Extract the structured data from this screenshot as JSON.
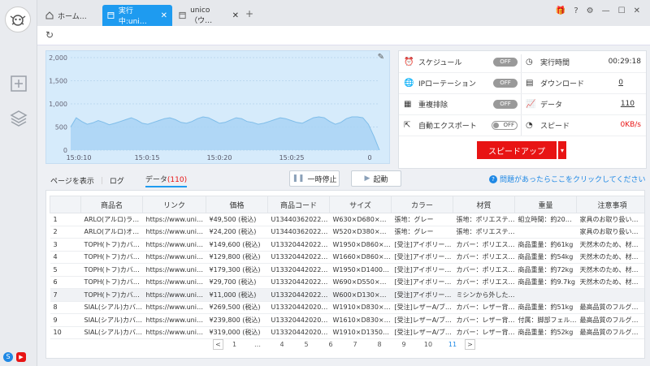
{
  "tabs": [
    {
      "label": "ホーム…",
      "icon": "home-icon"
    },
    {
      "label": "実行中:uni…",
      "icon": "window-icon",
      "active": true
    },
    {
      "label": "unico（ウ…",
      "icon": "window-icon"
    }
  ],
  "chart_data": {
    "type": "area",
    "y_ticks": [
      "2,000",
      "1,500",
      "1,000",
      "500",
      "0"
    ],
    "x_ticks": [
      "15:0:10",
      "15:0:15",
      "15:0:20",
      "15:0:25",
      "0"
    ],
    "ylim": [
      0,
      2000
    ],
    "values": [
      500,
      700,
      620,
      560,
      590,
      640,
      600,
      550,
      580,
      620,
      660,
      700,
      650,
      580,
      560,
      600,
      640,
      680,
      700,
      660,
      600,
      580,
      620,
      680,
      720,
      700,
      640,
      580,
      600,
      650,
      700,
      680,
      620,
      600,
      560,
      580,
      620,
      660,
      700,
      680,
      640,
      600,
      580,
      640,
      700,
      720,
      700,
      620,
      560,
      600,
      680,
      720,
      720,
      700,
      560,
      300,
      0
    ],
    "fill_color": "#a9d4f5",
    "line_color": "#7fbde9"
  },
  "panel": {
    "schedule_label": "スケジュール",
    "schedule_state": "OFF",
    "ip_label": "IPローテーション",
    "ip_state": "OFF",
    "dedupe_label": "重複排除",
    "dedupe_state": "OFF",
    "autoexport_label": "自動エクスポート",
    "autoexport_state": "OFF",
    "runtime_label": "実行時間",
    "runtime_value": "00:29:18",
    "download_label": "ダウンロード",
    "download_value": "0",
    "data_label": "データ",
    "data_value": "110",
    "speed_label": "スピード",
    "speed_value": "0KB/s",
    "speedup_button": "スピードアップ"
  },
  "subtabs": {
    "page": "ページを表示",
    "log": "ログ",
    "data": "データ",
    "data_count": "(110)"
  },
  "pause_button": "一時停止",
  "start_button": "起動",
  "help_text": "問題があったらここをクリックしてください",
  "table": {
    "headers": [
      "",
      "商品名",
      "リンク",
      "価格",
      "商品コード",
      "サイズ",
      "カラー",
      "材質",
      "重量",
      "注意事項"
    ],
    "rows": [
      [
        "1",
        "ARLO(アルロ)ラウ…",
        "https://www.unico-f…",
        "¥49,500 (税込)",
        "U13440362022123…",
        "W630×D680×H765…",
        "張地：グレー",
        "張地：ポリエステ…",
        "組立時間：約20分(…",
        "家具のお取り扱い…"
      ],
      [
        "2",
        "ARLO(アルロ)オッ…",
        "https://www.unico-f…",
        "¥24,200 (税込)",
        "U13440362022123…",
        "W520×D380×H480…",
        "張地：グレー",
        "張地：ポリエステ…",
        "",
        "家具のお取り扱い…"
      ],
      [
        "3",
        "TOPH(トフ)カバー…",
        "https://www.unico-f…",
        "¥149,600 (税込)",
        "U13320442022924…",
        "W1950×D860×H80…",
        "[受注]アイボリー(J…",
        "カバー：ポリエステ…",
        "商品重量：約61kg",
        "天然木のため、材…"
      ],
      [
        "4",
        "TOPH(トフ)カバー…",
        "https://www.unico-f…",
        "¥129,800 (税込)",
        "U13320442022924…",
        "W1660×D860×H80…",
        "[受注]アイボリー(J…",
        "カバー：ポリエステ…",
        "商品重量：約54kg",
        "天然木のため、材…"
      ],
      [
        "5",
        "TOPH(トフ)カバー…",
        "https://www.unico-f…",
        "¥179,300 (税込)",
        "U13320442022924…",
        "W1950×D1400×H8…",
        "[受注]アイボリー(J…",
        "カバー：ポリエステ…",
        "商品重量：約72kg",
        "天然木のため、材…"
      ],
      [
        "6",
        "TOPH(トフ)カバー…",
        "https://www.unico-f…",
        "¥29,700 (税込)",
        "U13320442022924…",
        "W690×D550×H420…",
        "[受注]アイボリー(J…",
        "カバー：ポリエステ…",
        "商品重量：約9.7kg",
        "天然木のため、材…"
      ],
      [
        "7",
        "TOPH(トフ)カバー…",
        "https://www.unico-f…",
        "¥11,000 (税込)",
        "U13320442022924…",
        "W600×D130×H200…",
        "[受注]アイボリー(J…",
        "ミシンから外した…",
        "",
        ""
      ],
      [
        "8",
        "SIAL(シアル)カバ…",
        "https://www.unico-f…",
        "¥269,500 (税込)",
        "U13320442020322…",
        "W1910×D830×H76…",
        "[受注]レザーA/ブラ…",
        "カバー：レザー背…",
        "商品重量：約51kg",
        "最高品質のフルグ…"
      ],
      [
        "9",
        "SIAL(シアル)カバ…",
        "https://www.unico-f…",
        "¥239,800 (税込)",
        "U13320442020322…",
        "W1610×D830×H76…",
        "[受注]レザーA/ブラ…",
        "カバー：レザー背…",
        "付属：脚部フェル…",
        "最高品質のフルグ…"
      ],
      [
        "10",
        "SIAL(シアル)カバ…",
        "https://www.unico-f…",
        "¥319,000 (税込)",
        "U13320442020322…",
        "W1910×D1350×H7…",
        "[受注]レザーA/ブラ…",
        "カバー：レザー背…",
        "商品重量：約52kg",
        "最高品質のフルグ…"
      ]
    ]
  },
  "pager": {
    "prev": "<",
    "next": ">",
    "pages": [
      "1",
      "…",
      "4",
      "5",
      "6",
      "7",
      "8",
      "9",
      "10",
      "11"
    ],
    "current": "11"
  },
  "accent": "#1e9bf0"
}
